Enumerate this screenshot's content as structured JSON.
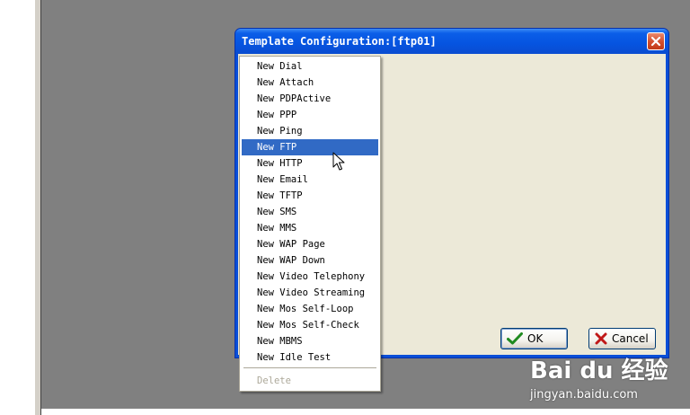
{
  "dialog": {
    "title": "Template Configuration:[ftp01]",
    "ok_label": "OK",
    "cancel_label": "Cancel"
  },
  "menu": {
    "items": [
      {
        "label": "New Dial"
      },
      {
        "label": "New Attach"
      },
      {
        "label": "New PDPActive"
      },
      {
        "label": "New PPP"
      },
      {
        "label": "New Ping"
      },
      {
        "label": "New FTP",
        "selected": true
      },
      {
        "label": "New HTTP"
      },
      {
        "label": "New Email"
      },
      {
        "label": "New TFTP"
      },
      {
        "label": "New SMS"
      },
      {
        "label": "New MMS"
      },
      {
        "label": "New WAP Page"
      },
      {
        "label": "New WAP Down"
      },
      {
        "label": "New Video Telephony"
      },
      {
        "label": "New Video Streaming"
      },
      {
        "label": "New Mos Self-Loop"
      },
      {
        "label": "New Mos Self-Check"
      },
      {
        "label": "New MBMS"
      },
      {
        "label": "New Idle Test"
      }
    ],
    "delete_label": "Delete"
  },
  "watermark": {
    "logo": "Bai du 经验",
    "url": "jingyan.baidu.com"
  },
  "colors": {
    "menu_highlight": "#316ac5",
    "titlebar": "#0654e0",
    "dialog_bg": "#ece9d8",
    "desktop": "#808080"
  },
  "icons": {
    "close": "close-x-icon",
    "ok": "checkmark-icon",
    "cancel": "red-x-icon",
    "cursor": "arrow-cursor-icon"
  }
}
